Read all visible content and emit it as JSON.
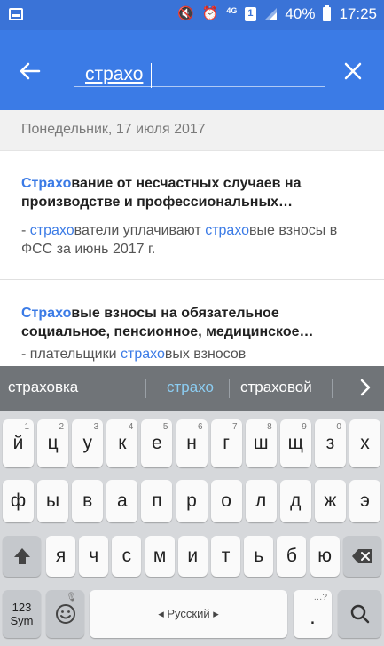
{
  "status_bar": {
    "network": "4G",
    "battery": "40%",
    "time": "17:25"
  },
  "search": {
    "query": "страхо",
    "placeholder": ""
  },
  "results": {
    "date_header": "Понедельник, 17 июля 2017",
    "items": [
      {
        "title_hl": "Страхо",
        "title_rest": "вание от несчастных случаев на производстве и профессиональных…",
        "snippet": [
          {
            "t": "- ",
            "hl": false
          },
          {
            "t": "страхо",
            "hl": true
          },
          {
            "t": "ватели уплачивают ",
            "hl": false
          },
          {
            "t": "страхо",
            "hl": true
          },
          {
            "t": "вые взносы в ФСС за июнь 2017 г.",
            "hl": false
          }
        ]
      },
      {
        "title_hl": "Страхо",
        "title_rest": "вые взносы на обязательное социальное, пенсионное, медицинское…",
        "snippet": [
          {
            "t": "- плательщики ",
            "hl": false
          },
          {
            "t": "страхо",
            "hl": true
          },
          {
            "t": "вых взносов",
            "hl": false
          }
        ]
      }
    ]
  },
  "keyboard": {
    "suggestions": [
      "страховка",
      "страхо",
      "страховой"
    ],
    "row1": [
      {
        "k": "й",
        "n": "1"
      },
      {
        "k": "ц",
        "n": "2"
      },
      {
        "k": "у",
        "n": "3"
      },
      {
        "k": "к",
        "n": "4"
      },
      {
        "k": "е",
        "n": "5"
      },
      {
        "k": "н",
        "n": "6"
      },
      {
        "k": "г",
        "n": "7"
      },
      {
        "k": "ш",
        "n": "8"
      },
      {
        "k": "щ",
        "n": "9"
      },
      {
        "k": "з",
        "n": "0"
      },
      {
        "k": "х",
        "n": ""
      }
    ],
    "row2": [
      "ф",
      "ы",
      "в",
      "а",
      "п",
      "р",
      "о",
      "л",
      "д",
      "ж",
      "э"
    ],
    "row3": [
      "я",
      "ч",
      "с",
      "м",
      "и",
      "т",
      "ь",
      "б",
      "ю"
    ],
    "sym_label_1": "123",
    "sym_label_2": "Sym",
    "space_label": "◂ Русский ▸",
    "period": ".",
    "period_hint": "…?"
  },
  "colors": {
    "status_bar": "#3a73d7",
    "app_bar": "#3b7be6",
    "highlight": "#3b7be6",
    "suggestion_bar": "#707478",
    "suggestion_selected": "#8ccdf2"
  }
}
